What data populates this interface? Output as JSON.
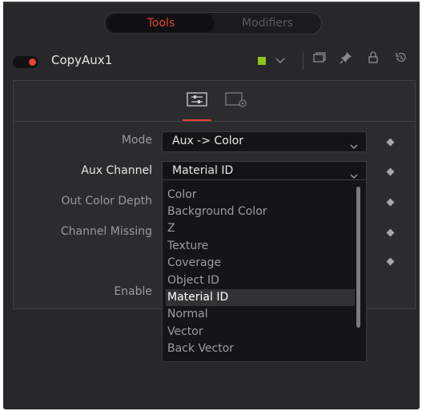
{
  "tabs": {
    "tools": "Tools",
    "modifiers": "Modifiers"
  },
  "node": {
    "title": "CopyAux1",
    "color_swatch": "#8fc31f",
    "toggle_color": "#e54335"
  },
  "header_icons": [
    "color-swatch-chevron-icon",
    "version-icon",
    "pin-icon",
    "lock-icon",
    "reset-icon"
  ],
  "controls": {
    "mode": {
      "label": "Mode",
      "value": "Aux -> Color"
    },
    "aux_channel": {
      "label": "Aux Channel",
      "value": "Material ID"
    },
    "out_color_depth": {
      "label": "Out Color Depth"
    },
    "channel_missing": {
      "label": "Channel Missing"
    },
    "enable": {
      "label": "Enable"
    }
  },
  "dropdown": {
    "options": [
      "Color",
      "Background Color",
      "Z",
      "Texture",
      "Coverage",
      "Object ID",
      "Material ID",
      "Normal",
      "Vector",
      "Back Vector"
    ],
    "selected": "Material ID"
  },
  "accent_color": "#e54335"
}
